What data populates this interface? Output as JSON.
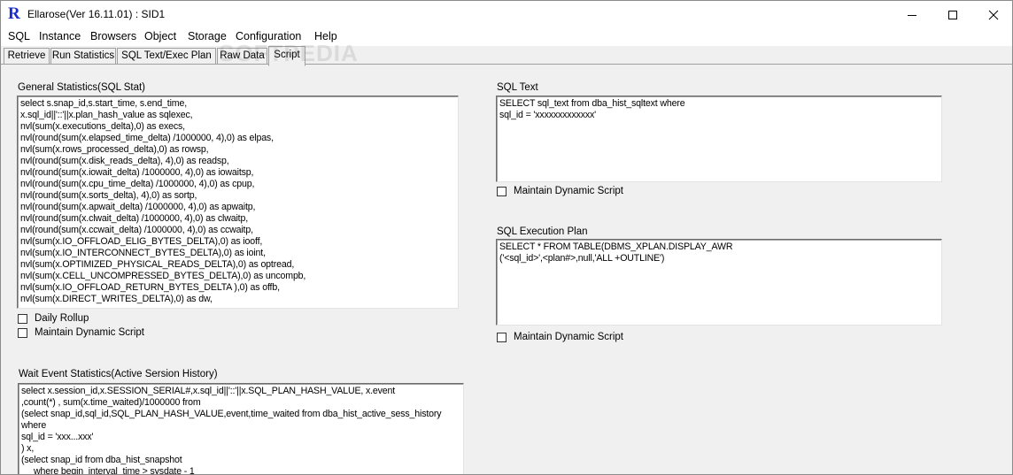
{
  "window": {
    "title": "Ellarose(Ver 16.11.01) : SID1",
    "app_icon_glyph": "R",
    "controls": {
      "minimize": "minimize-icon",
      "maximize": "maximize-icon",
      "close": "close-icon"
    }
  },
  "menu": [
    "SQL",
    "Instance",
    "Browsers",
    "Object",
    "Storage",
    "Configuration",
    "Help"
  ],
  "tabs": [
    {
      "label": "Retrieve",
      "active": false
    },
    {
      "label": "Run Statistics",
      "active": false
    },
    {
      "label": "SQL Text/Exec Plan",
      "active": false
    },
    {
      "label": "Raw Data",
      "active": false
    },
    {
      "label": "Script",
      "active": true
    }
  ],
  "watermark": "SOFTPEDIA",
  "general_stats": {
    "label": "General Statistics(SQL Stat)",
    "lines": [
      "select s.snap_id,s.start_time, s.end_time,",
      "x.sql_id||'::'||x.plan_hash_value as sqlexec,",
      "nvl(sum(x.executions_delta),0) as execs,",
      "nvl(round(sum(x.elapsed_time_delta) /1000000, 4),0) as elpas,",
      "nvl(sum(x.rows_processed_delta),0) as rowsp,",
      "nvl(round(sum(x.disk_reads_delta), 4),0) as readsp,",
      "nvl(round(sum(x.iowait_delta) /1000000, 4),0) as iowaitsp,",
      "nvl(round(sum(x.cpu_time_delta) /1000000, 4),0) as cpup,",
      "nvl(round(sum(x.sorts_delta), 4),0) as sortp,",
      "nvl(round(sum(x.apwait_delta) /1000000, 4),0) as apwaitp,",
      "nvl(round(sum(x.clwait_delta) /1000000, 4),0) as clwaitp,",
      "nvl(round(sum(x.ccwait_delta) /1000000, 4),0) as ccwaitp,",
      "nvl(sum(x.IO_OFFLOAD_ELIG_BYTES_DELTA),0) as iooff,",
      "nvl(sum(x.IO_INTERCONNECT_BYTES_DELTA),0) as ioint,",
      "nvl(sum(x.OPTIMIZED_PHYSICAL_READS_DELTA),0) as optread,",
      "nvl(sum(x.CELL_UNCOMPRESSED_BYTES_DELTA),0) as uncompb,",
      "nvl(sum(x.IO_OFFLOAD_RETURN_BYTES_DELTA ),0) as offb,",
      "nvl(sum(x.DIRECT_WRITES_DELTA),0) as dw,"
    ],
    "daily_rollup_label": "Daily Rollup",
    "daily_rollup_checked": false,
    "maintain_label": "Maintain Dynamic Script",
    "maintain_checked": false
  },
  "wait_event": {
    "label": "Wait Event Statistics(Active Sersion History)",
    "lines": [
      "select x.session_id,x.SESSION_SERIAL#,x.sql_id||'::'||x.SQL_PLAN_HASH_VALUE, x.event",
      ",count(*) , sum(x.time_waited)/1000000 from",
      "(select snap_id,sql_id,SQL_PLAN_HASH_VALUE,event,time_waited from dba_hist_active_sess_history",
      "where",
      "sql_id = 'xxx...xxx'",
      ") x,",
      "(select snap_id from dba_hist_snapshot",
      "     where begin_interval_time > sysdate - 1"
    ]
  },
  "sql_text": {
    "label": "SQL Text",
    "lines": [
      "SELECT sql_text from dba_hist_sqltext where",
      "sql_id = 'xxxxxxxxxxxxx'"
    ],
    "maintain_label": "Maintain Dynamic Script",
    "maintain_checked": false
  },
  "exec_plan": {
    "label": "SQL Execution Plan",
    "lines": [
      "SELECT * FROM TABLE(DBMS_XPLAN.DISPLAY_AWR",
      "('<sql_id>',<plan#>,null,'ALL +OUTLINE')"
    ],
    "maintain_label": "Maintain Dynamic Script",
    "maintain_checked": false
  }
}
